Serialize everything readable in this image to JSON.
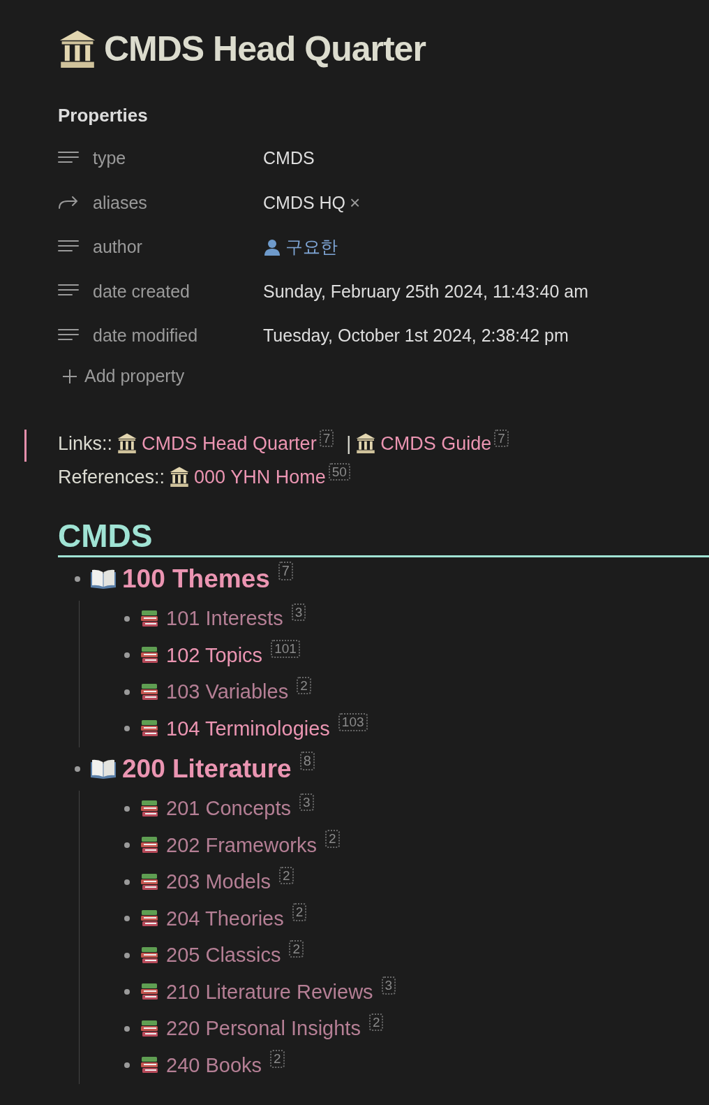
{
  "title": "CMDS Head Quarter",
  "properties": {
    "heading": "Properties",
    "add_label": "Add property",
    "rows": [
      {
        "kind": "text",
        "name": "type",
        "value": "CMDS"
      },
      {
        "kind": "list",
        "name": "aliases",
        "value": "CMDS HQ",
        "remove": "×"
      },
      {
        "kind": "person",
        "name": "author",
        "value": "구요한"
      },
      {
        "kind": "text",
        "name": "date created",
        "value": "Sunday, February 25th 2024, 11:43:40 am"
      },
      {
        "kind": "text",
        "name": "date modified",
        "value": "Tuesday, October 1st 2024, 2:38:42 pm"
      }
    ]
  },
  "link_lines": [
    {
      "label": "Links::",
      "separator": "|",
      "links": [
        {
          "text": "CMDS Head Quarter",
          "count": "7"
        },
        {
          "text": "CMDS Guide",
          "count": "7"
        }
      ]
    },
    {
      "label": "References::",
      "links": [
        {
          "text": "000 YHN Home",
          "count": "50"
        }
      ]
    }
  ],
  "section": {
    "heading": "CMDS",
    "items": [
      {
        "text": "100 Themes",
        "count": "7",
        "dimmed": false,
        "children": [
          {
            "text": "101 Interests",
            "count": "3",
            "dimmed": true
          },
          {
            "text": "102 Topics",
            "count": "101",
            "dimmed": false
          },
          {
            "text": "103 Variables",
            "count": "2",
            "dimmed": true
          },
          {
            "text": "104 Terminologies",
            "count": "103",
            "dimmed": false
          }
        ]
      },
      {
        "text": "200 Literature",
        "count": "8",
        "dimmed": false,
        "children": [
          {
            "text": "201 Concepts",
            "count": "3",
            "dimmed": true
          },
          {
            "text": "202 Frameworks",
            "count": "2",
            "dimmed": true
          },
          {
            "text": "203 Models",
            "count": "2",
            "dimmed": true
          },
          {
            "text": "204 Theories",
            "count": "2",
            "dimmed": true
          },
          {
            "text": "205 Classics",
            "count": "2",
            "dimmed": true
          },
          {
            "text": "210 Literature Reviews",
            "count": "3",
            "dimmed": true
          },
          {
            "text": "220 Personal Insights",
            "count": "2",
            "dimmed": true
          },
          {
            "text": "240 Books",
            "count": "2",
            "dimmed": true
          }
        ]
      }
    ]
  }
}
